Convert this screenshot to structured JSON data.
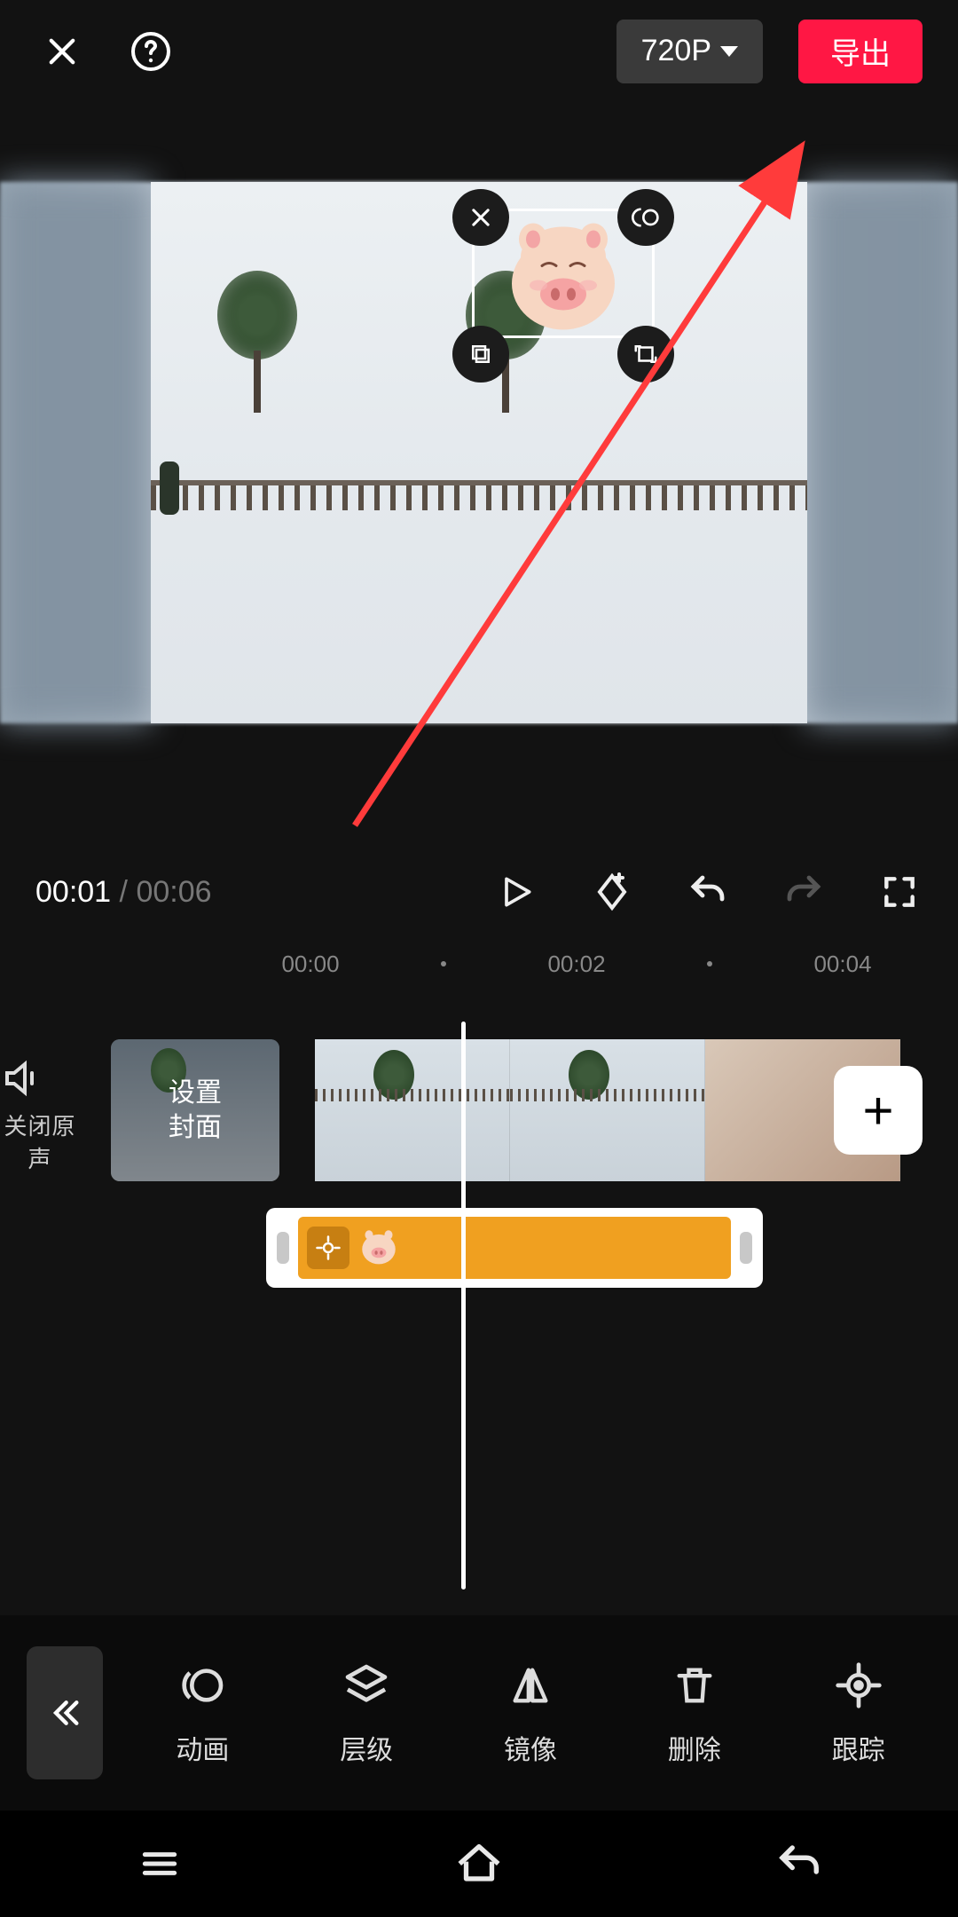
{
  "header": {
    "resolution": "720P",
    "export_label": "导出"
  },
  "preview": {
    "sticker_controls": [
      "close",
      "mirror-h",
      "copy",
      "rotate"
    ]
  },
  "playback": {
    "current": "00:01",
    "separator": " / ",
    "duration": "00:06"
  },
  "ruler": {
    "marks": [
      "00:00",
      "00:02",
      "00:04"
    ]
  },
  "tracks": {
    "mute_label": "关闭原声",
    "cover_line1": "设置",
    "cover_line2": "封面",
    "add_label": "+"
  },
  "toolbar": {
    "items": [
      {
        "id": "animation",
        "label": "动画"
      },
      {
        "id": "layer",
        "label": "层级"
      },
      {
        "id": "mirror",
        "label": "镜像"
      },
      {
        "id": "delete",
        "label": "删除"
      },
      {
        "id": "track",
        "label": "跟踪"
      }
    ]
  },
  "colors": {
    "accent": "#ff1744",
    "sticker_track": "#f0a020"
  }
}
